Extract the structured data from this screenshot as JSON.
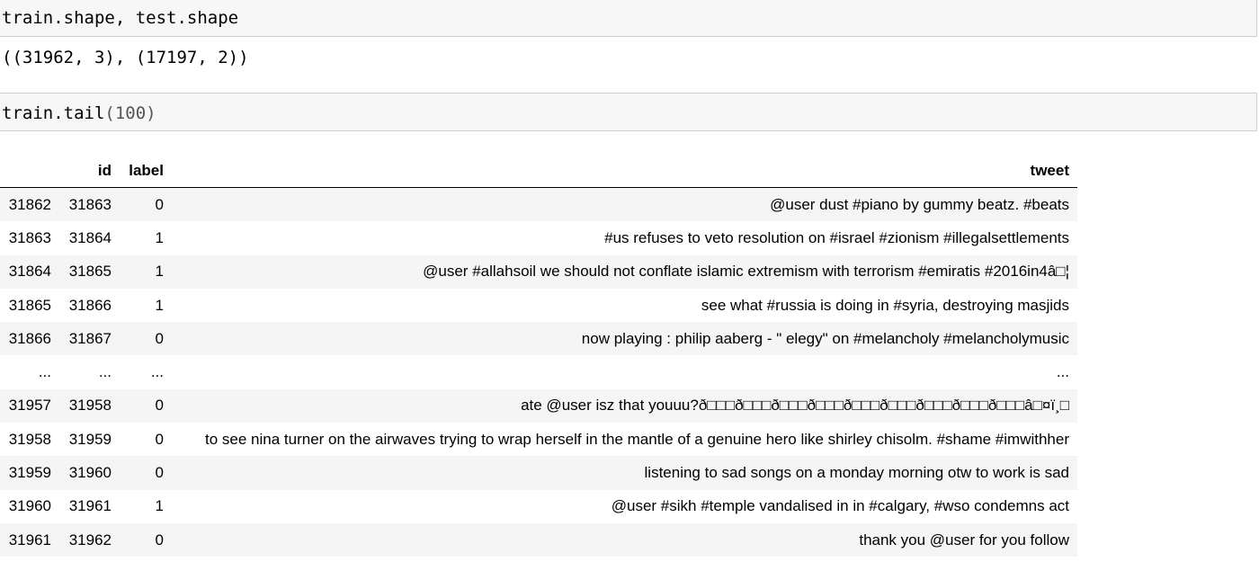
{
  "cells": [
    {
      "code": "train.shape, test.shape",
      "output": "((31962, 3), (17197, 2))"
    },
    {
      "code_fn": "train.tail",
      "code_args": "(100)"
    }
  ],
  "dataframe": {
    "columns": [
      "",
      "id",
      "label",
      "tweet"
    ],
    "rows": [
      {
        "index": "31862",
        "id": "31863",
        "label": "0",
        "tweet": "@user dust #piano by gummy beatz. #beats"
      },
      {
        "index": "31863",
        "id": "31864",
        "label": "1",
        "tweet": "#us refuses to veto resolution on #israel #zionism #illegalsettlements"
      },
      {
        "index": "31864",
        "id": "31865",
        "label": "1",
        "tweet": "@user #allahsoil we should not conflate islamic extremism with terrorism #emiratis #2016in4â□¦"
      },
      {
        "index": "31865",
        "id": "31866",
        "label": "1",
        "tweet": "see what #russia is doing in #syria, destroying masjids"
      },
      {
        "index": "31866",
        "id": "31867",
        "label": "0",
        "tweet": "now playing : philip aaberg - \" elegy\" on #melancholy #melancholymusic"
      },
      {
        "index": "...",
        "id": "...",
        "label": "...",
        "tweet": "..."
      },
      {
        "index": "31957",
        "id": "31958",
        "label": "0",
        "tweet": "ate @user isz that youuu?ð□□□ð□□□ð□□□ð□□□ð□□□ð□□□ð□□□ð□□□ð□□□â□¤ï¸□"
      },
      {
        "index": "31958",
        "id": "31959",
        "label": "0",
        "tweet": "to see nina turner on the airwaves trying to wrap herself in the mantle of a genuine hero like shirley chisolm. #shame #imwithher"
      },
      {
        "index": "31959",
        "id": "31960",
        "label": "0",
        "tweet": "listening to sad songs on a monday morning otw to work is sad"
      },
      {
        "index": "31960",
        "id": "31961",
        "label": "1",
        "tweet": "@user #sikh #temple vandalised in in #calgary, #wso condemns act"
      },
      {
        "index": "31961",
        "id": "31962",
        "label": "0",
        "tweet": "thank you @user for you follow"
      }
    ]
  }
}
